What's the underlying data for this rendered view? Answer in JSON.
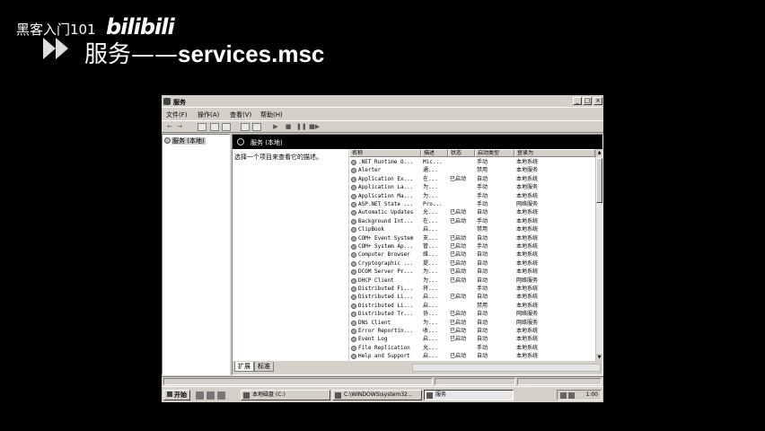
{
  "header": {
    "channel": "黑客入门101",
    "logo": "bilibili",
    "title_main": "服务",
    "title_dash": "——",
    "title_sub": "services.msc"
  },
  "window": {
    "title": "服务",
    "menu": [
      "文件(F)",
      "操作(A)",
      "查看(V)",
      "帮助(H)"
    ],
    "tree_root": "服务 (本地)",
    "right_title": "服务 (本地)",
    "description": "选择一个项目来查看它的描述。",
    "columns": [
      "名称",
      "描述",
      "状态",
      "启动类型",
      "登录为"
    ],
    "rows": [
      {
        "name": ".NET Runtime O...",
        "desc": "Mic...",
        "status": "",
        "startup": "手动",
        "logon": "本地系统"
      },
      {
        "name": "Alerter",
        "desc": "通...",
        "status": "",
        "startup": "禁用",
        "logon": "本地服务"
      },
      {
        "name": "Application Ex...",
        "desc": "在...",
        "status": "已启动",
        "startup": "自动",
        "logon": "本地系统"
      },
      {
        "name": "Application La...",
        "desc": "为...",
        "status": "",
        "startup": "手动",
        "logon": "本地服务"
      },
      {
        "name": "Application Ma...",
        "desc": "为...",
        "status": "",
        "startup": "手动",
        "logon": "本地系统"
      },
      {
        "name": "ASP.NET State ...",
        "desc": "Pro...",
        "status": "",
        "startup": "手动",
        "logon": "网络服务"
      },
      {
        "name": "Automatic Updates",
        "desc": "允...",
        "status": "已启动",
        "startup": "自动",
        "logon": "本地系统"
      },
      {
        "name": "Background Int...",
        "desc": "在...",
        "status": "已启动",
        "startup": "手动",
        "logon": "本地系统"
      },
      {
        "name": "ClipBook",
        "desc": "启...",
        "status": "",
        "startup": "禁用",
        "logon": "本地系统"
      },
      {
        "name": "COM+ Event System",
        "desc": "支...",
        "status": "已启动",
        "startup": "自动",
        "logon": "本地系统"
      },
      {
        "name": "COM+ System Ap...",
        "desc": "管...",
        "status": "已启动",
        "startup": "手动",
        "logon": "本地系统"
      },
      {
        "name": "Computer Browser",
        "desc": "维...",
        "status": "已启动",
        "startup": "自动",
        "logon": "本地系统"
      },
      {
        "name": "Cryptographic ...",
        "desc": "提...",
        "status": "已启动",
        "startup": "自动",
        "logon": "本地系统"
      },
      {
        "name": "DCOM Server Pr...",
        "desc": "为...",
        "status": "已启动",
        "startup": "自动",
        "logon": "本地系统"
      },
      {
        "name": "DHCP Client",
        "desc": "为...",
        "status": "已启动",
        "startup": "自动",
        "logon": "网络服务"
      },
      {
        "name": "Distributed Fi...",
        "desc": "将...",
        "status": "",
        "startup": "手动",
        "logon": "本地系统"
      },
      {
        "name": "Distributed Li...",
        "desc": "启...",
        "status": "已启动",
        "startup": "自动",
        "logon": "本地系统"
      },
      {
        "name": "Distributed Li...",
        "desc": "启...",
        "status": "",
        "startup": "禁用",
        "logon": "本地系统"
      },
      {
        "name": "Distributed Tr...",
        "desc": "协...",
        "status": "已启动",
        "startup": "自动",
        "logon": "网络服务"
      },
      {
        "name": "DNS Client",
        "desc": "为...",
        "status": "已启动",
        "startup": "自动",
        "logon": "网络服务"
      },
      {
        "name": "Error Reportin...",
        "desc": "收...",
        "status": "已启动",
        "startup": "自动",
        "logon": "本地系统"
      },
      {
        "name": "Event Log",
        "desc": "启...",
        "status": "已启动",
        "startup": "自动",
        "logon": "本地系统"
      },
      {
        "name": "File Replication",
        "desc": "允...",
        "status": "",
        "startup": "手动",
        "logon": "本地系统"
      },
      {
        "name": "Help and Support",
        "desc": "启...",
        "status": "已启动",
        "startup": "自动",
        "logon": "本地系统"
      }
    ],
    "tabs": [
      "扩展",
      "标准"
    ]
  },
  "taskbar": {
    "start": "开始",
    "tasks": [
      "本地磁盘 (C:)",
      "C:\\WINDOWS\\system32...",
      "服务"
    ],
    "clock": "1:00"
  }
}
